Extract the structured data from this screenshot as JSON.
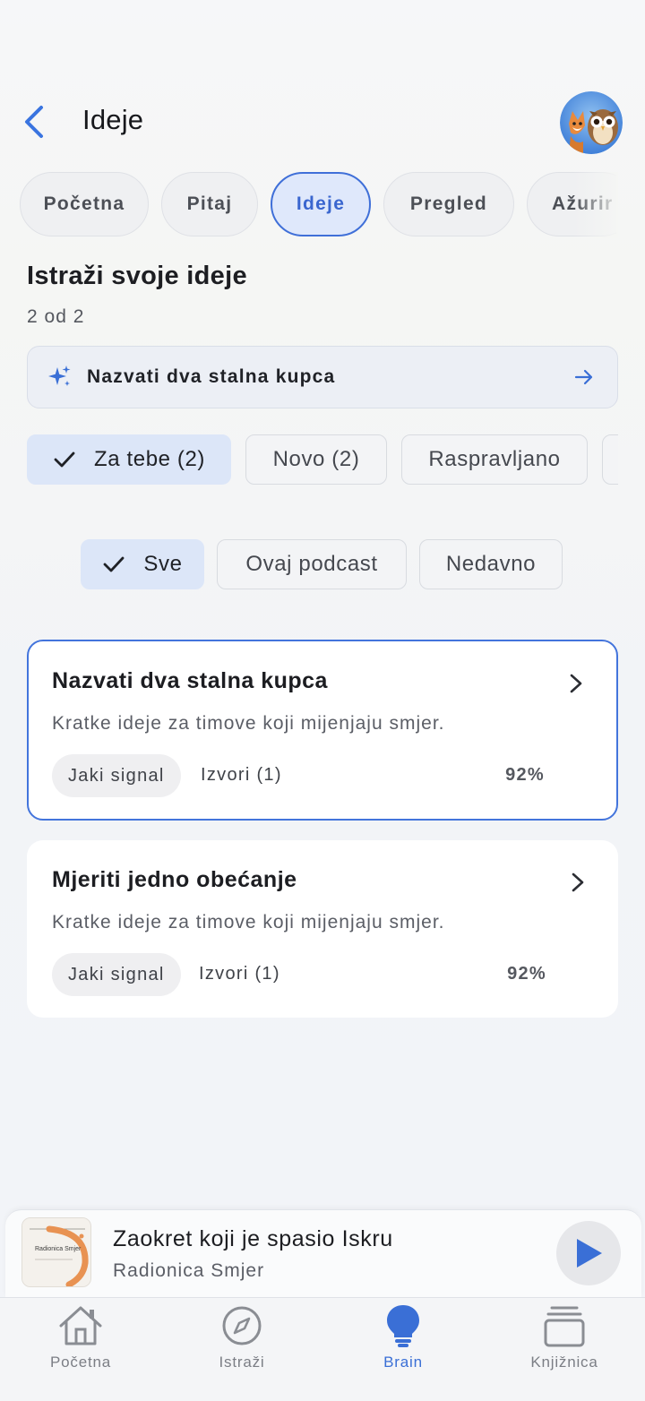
{
  "header": {
    "title": "Ideje"
  },
  "tabs": [
    {
      "label": "Početna",
      "active": false
    },
    {
      "label": "Pitaj",
      "active": false
    },
    {
      "label": "Ideje",
      "active": true
    },
    {
      "label": "Pregled",
      "active": false
    },
    {
      "label": "Ažurir",
      "active": false
    }
  ],
  "section": {
    "title": "Istraži svoje ideje",
    "count": "2 od 2"
  },
  "suggestion": {
    "text": "Nazvati dva stalna kupca"
  },
  "filters": [
    {
      "label": "Za tebe (2)",
      "active": true
    },
    {
      "label": "Novo (2)",
      "active": false
    },
    {
      "label": "Raspravljano",
      "active": false
    }
  ],
  "scope_filters": [
    {
      "label": "Sve",
      "active": true
    },
    {
      "label": "Ovaj podcast",
      "active": false
    },
    {
      "label": "Nedavno",
      "active": false
    }
  ],
  "ideas": [
    {
      "title": "Nazvati dva stalna kupca",
      "description": "Kratke ideje za timove koji mijenjaju smjer.",
      "badge": "Jaki signal",
      "sources": "Izvori (1)",
      "score": "92%",
      "selected": true
    },
    {
      "title": "Mjeriti jedno obećanje",
      "description": "Kratke ideje za timove koji mijenjaju smjer.",
      "badge": "Jaki signal",
      "sources": "Izvori (1)",
      "score": "92%",
      "selected": false
    }
  ],
  "player": {
    "title": "Zaokret koji je spasio Iskru",
    "subtitle": "Radionica Smjer",
    "cover_text": "Radionica Smjer",
    "accent": "#3a6fd6"
  },
  "nav": [
    {
      "label": "Početna",
      "icon": "home-icon",
      "active": false
    },
    {
      "label": "Istraži",
      "icon": "compass-icon",
      "active": false
    },
    {
      "label": "Brain",
      "icon": "lightbulb-icon",
      "active": true
    },
    {
      "label": "Knjižnica",
      "icon": "library-icon",
      "active": false
    }
  ],
  "colors": {
    "accent": "#3a6fd6",
    "selected_border": "#4374dc",
    "chip_active_bg": "#dce6f8"
  }
}
